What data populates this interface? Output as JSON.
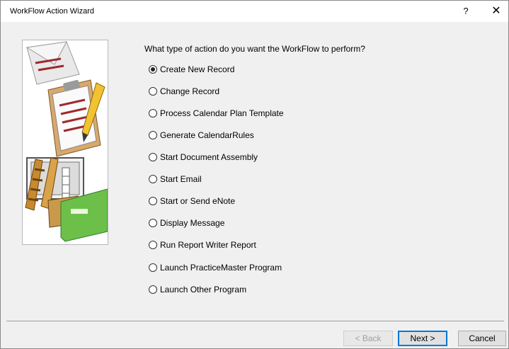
{
  "window": {
    "title": "WorkFlow Action Wizard",
    "help_label": "?",
    "close_label": "✕"
  },
  "prompt": "What type of action do you want the WorkFlow to perform?",
  "options": [
    {
      "label": "Create New Record",
      "selected": true
    },
    {
      "label": "Change Record",
      "selected": false
    },
    {
      "label": "Process Calendar Plan Template",
      "selected": false
    },
    {
      "label": "Generate CalendarRules",
      "selected": false
    },
    {
      "label": "Start Document Assembly",
      "selected": false
    },
    {
      "label": "Start Email",
      "selected": false
    },
    {
      "label": "Start or Send eNote",
      "selected": false
    },
    {
      "label": "Display Message",
      "selected": false
    },
    {
      "label": "Run Report Writer Report",
      "selected": false
    },
    {
      "label": "Launch PracticeMaster Program",
      "selected": false
    },
    {
      "label": "Launch Other Program",
      "selected": false
    }
  ],
  "buttons": {
    "back": "< Back",
    "next": "Next >",
    "cancel": "Cancel"
  },
  "colors": {
    "accent": "#0078d7",
    "art_green": "#6cc04a",
    "art_tan": "#d8a24b",
    "art_red": "#a0282d"
  }
}
